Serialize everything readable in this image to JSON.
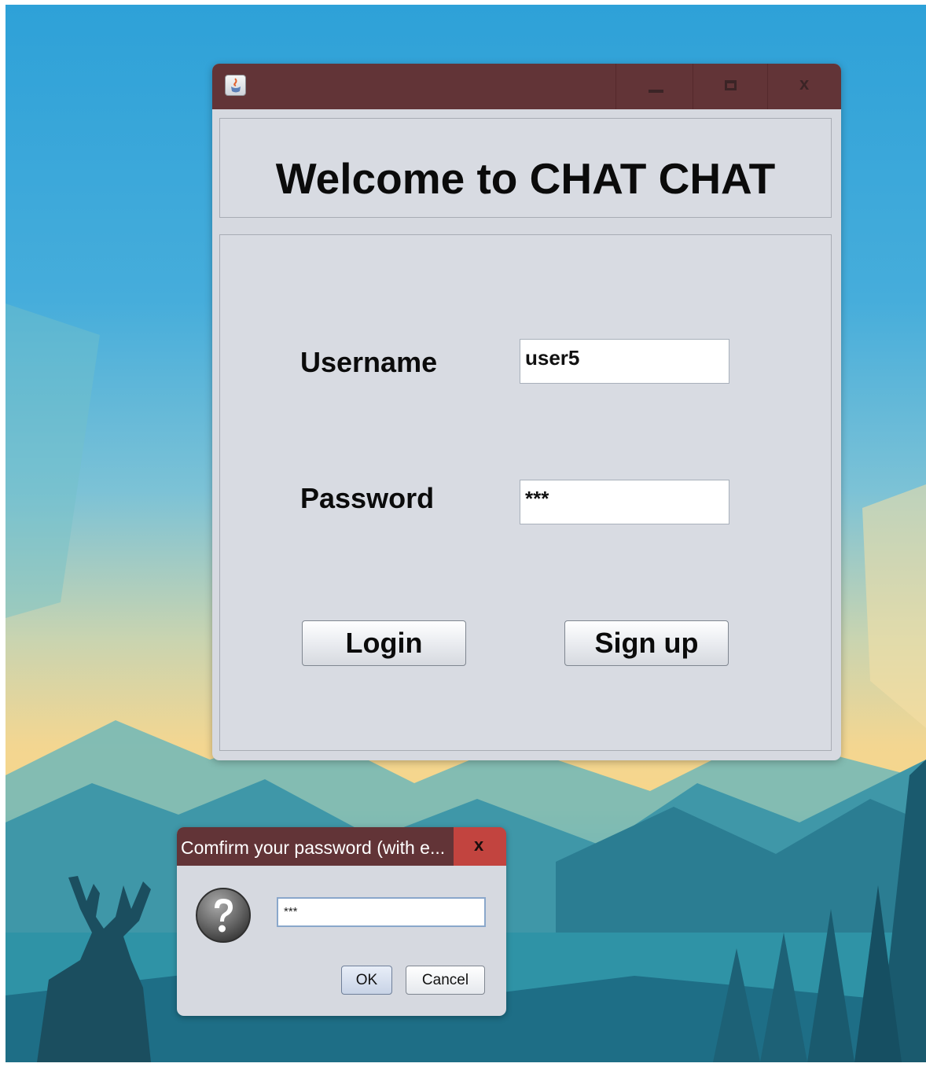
{
  "main_window": {
    "title": "",
    "header_text": "Welcome to CHAT CHAT",
    "controls": {
      "minimize_icon": "minimize-icon",
      "maximize_icon": "maximize-icon",
      "close_glyph": "x"
    },
    "form": {
      "username_label": "Username",
      "username_value": "user5",
      "password_label": "Password",
      "password_value": "***",
      "login_label": "Login",
      "signup_label": "Sign up"
    }
  },
  "dialog": {
    "title": "Comfirm your password (with e...",
    "close_glyph": "x",
    "icon": "question-icon",
    "input_value": "***",
    "ok_label": "OK",
    "cancel_label": "Cancel"
  },
  "colors": {
    "titlebar": "#623437",
    "dialog_close": "#c2443f",
    "window_bg": "#d6d9e0"
  }
}
